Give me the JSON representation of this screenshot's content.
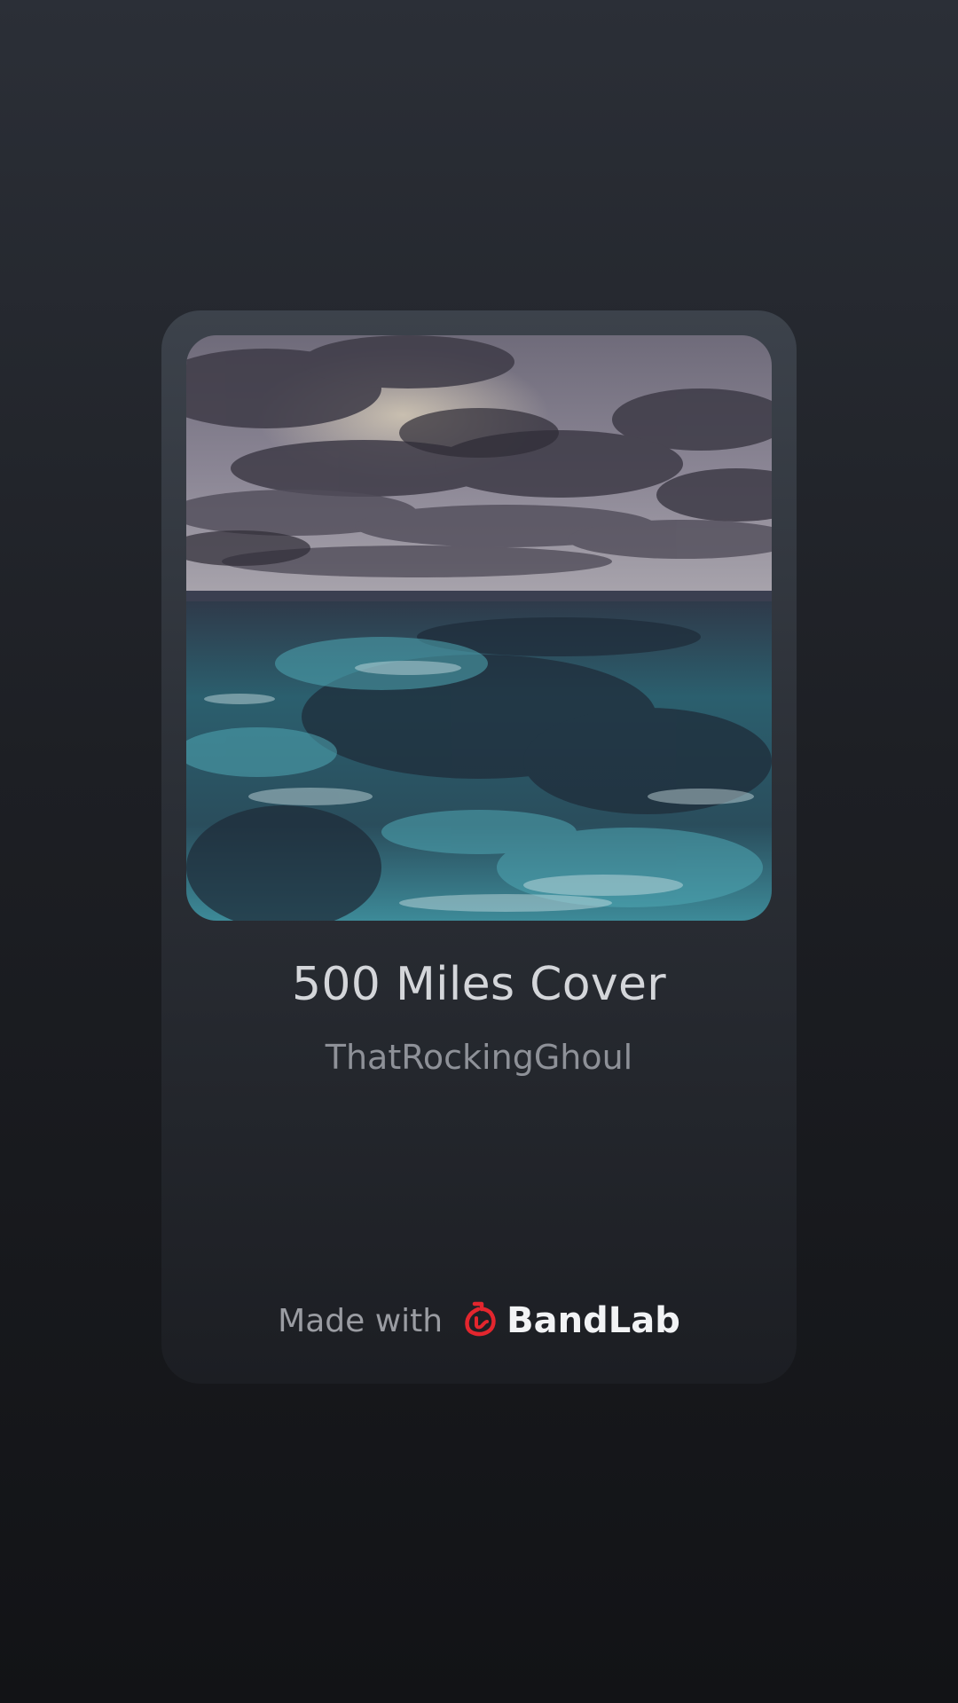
{
  "track": {
    "title": "500 Miles Cover",
    "artist": "ThatRockingGhoul",
    "cover_art": "stormy-ocean-waves-under-cloudy-sky"
  },
  "footer": {
    "made_with_label": "Made with",
    "brand_name": "BandLab",
    "brand_icon": "bandlab-logo-icon",
    "brand_color": "#e3262e"
  },
  "theme": {
    "background_top": "#2b2f37",
    "background_bottom": "#121316",
    "title_color": "#d4d6da",
    "artist_color": "#8e9198"
  }
}
